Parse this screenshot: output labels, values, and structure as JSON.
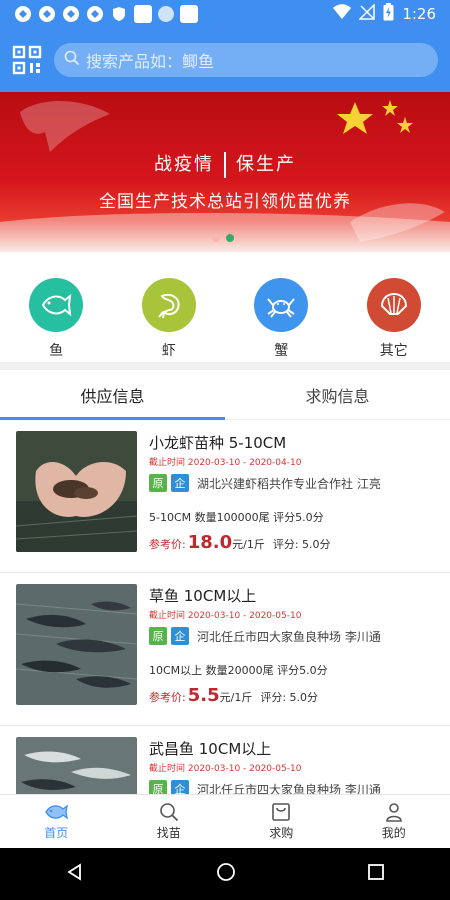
{
  "status_bar": {
    "time": "1:26"
  },
  "header": {
    "search_placeholder": "搜索产品如：鲫鱼"
  },
  "banner": {
    "line1_left": "战疫情",
    "line1_right": "保生产",
    "line2": "全国生产技术总站引领优苗优养"
  },
  "categories": [
    {
      "label": "鱼",
      "color": "#26bfa0",
      "icon": "fish-icon"
    },
    {
      "label": "虾",
      "color": "#a8c43a",
      "icon": "shrimp-icon"
    },
    {
      "label": "蟹",
      "color": "#3f95ee",
      "icon": "crab-icon"
    },
    {
      "label": "其它",
      "color": "#d14a34",
      "icon": "shell-icon"
    }
  ],
  "tabs": [
    {
      "label": "供应信息",
      "active": true
    },
    {
      "label": "求购信息",
      "active": false
    }
  ],
  "products": [
    {
      "title": "小龙虾苗种 5-10CM",
      "deadline": "截止时间 2020-03-10 - 2020-04-10",
      "badge_yuan": "原",
      "badge_qi": "企",
      "seller": "湖北兴建虾稻共作专业合作社  江亮",
      "specs": "5-10CM  数量100000尾  评分5.0分",
      "price_label": "参考价:",
      "price": "18.0",
      "unit": "元/1斤",
      "score": "评分: 5.0分"
    },
    {
      "title": "草鱼 10CM以上",
      "deadline": "截止时间 2020-03-10 - 2020-05-10",
      "badge_yuan": "原",
      "badge_qi": "企",
      "seller": "河北任丘市四大家鱼良种场  李川通",
      "specs": "10CM以上  数量20000尾  评分5.0分",
      "price_label": "参考价:",
      "price": "5.5",
      "unit": "元/1斤",
      "score": "评分: 5.0分"
    },
    {
      "title": "武昌鱼 10CM以上",
      "deadline": "截止时间 2020-03-10 - 2020-05-10",
      "badge_yuan": "原",
      "badge_qi": "企",
      "seller": "河北任丘市四大家鱼良种场  李川通",
      "specs": "",
      "price_label": "",
      "price": "",
      "unit": "",
      "score": ""
    }
  ],
  "bottom_nav": [
    {
      "label": "首页",
      "icon": "home-fish-icon",
      "active": true
    },
    {
      "label": "找苗",
      "icon": "search-icon",
      "active": false
    },
    {
      "label": "求购",
      "icon": "bag-icon",
      "active": false
    },
    {
      "label": "我的",
      "icon": "user-icon",
      "active": false
    }
  ],
  "colors": {
    "primary": "#3f8ff0",
    "price_red": "#c0282e"
  }
}
